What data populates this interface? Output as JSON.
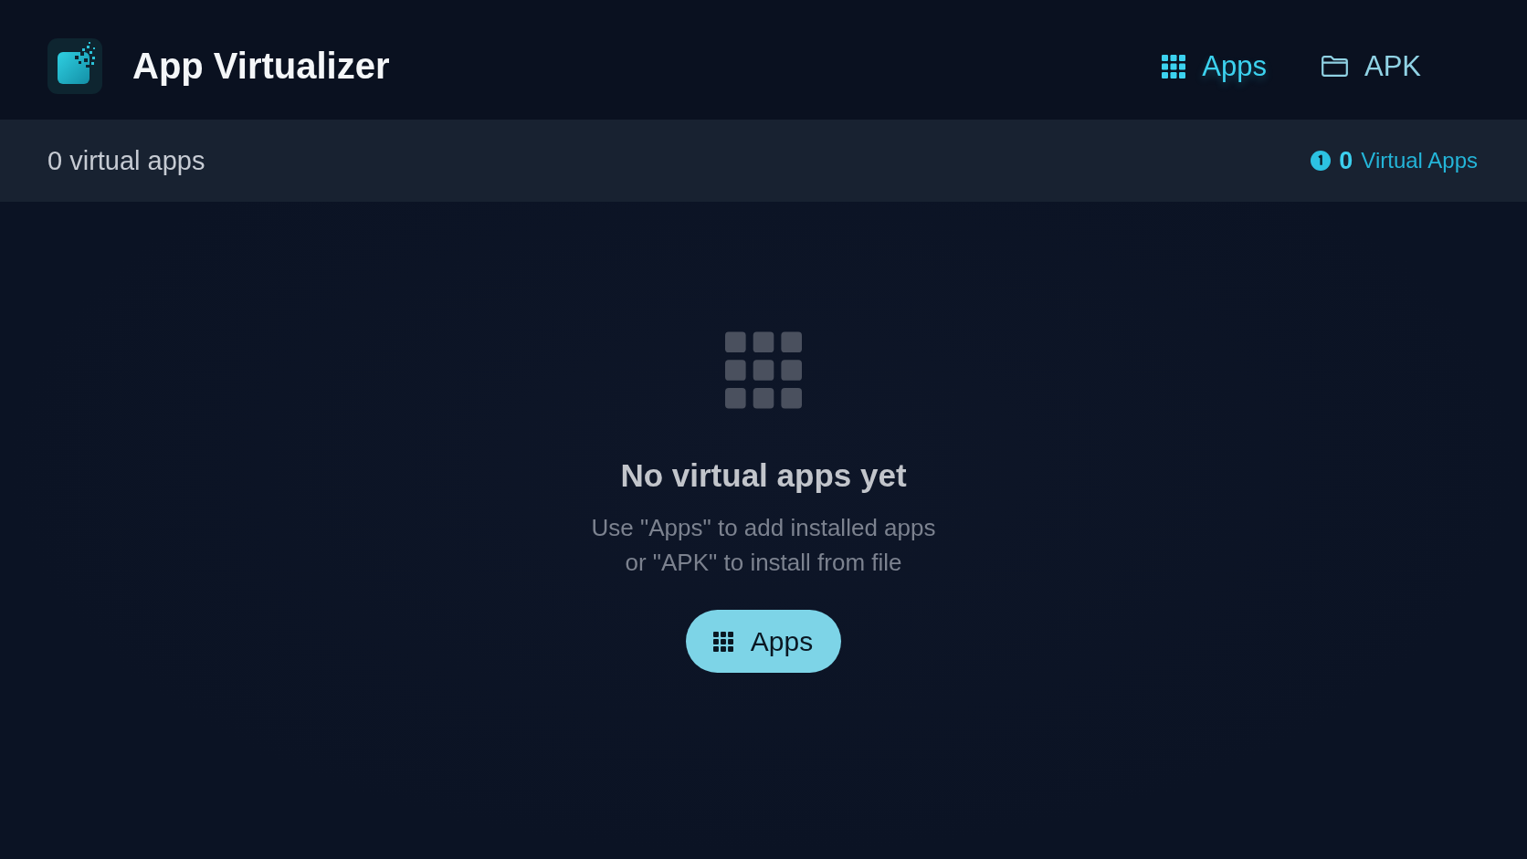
{
  "app_bar": {
    "title": "App Virtualizer",
    "tabs": [
      {
        "label": "Apps",
        "selected": true
      },
      {
        "label": "APK",
        "selected": false
      }
    ]
  },
  "status_bar": {
    "summary": "0 virtual apps",
    "counter": {
      "count": "0",
      "label": "Virtual Apps"
    }
  },
  "empty_state": {
    "title": "No virtual apps yet",
    "description": "Use \"Apps\" to add installed apps\nor \"APK\" to install from file",
    "button": {
      "label": "Apps"
    }
  }
}
